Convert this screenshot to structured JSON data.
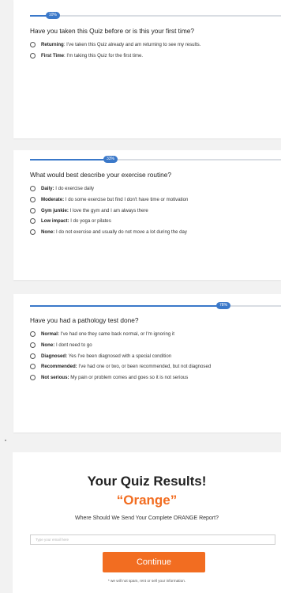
{
  "accent_color": "#3a78c9",
  "brand_color": "#f26d21",
  "cards": [
    {
      "progress": 10,
      "progress_label": "10%",
      "question": "Have you taken this Quiz before or is this your first time?",
      "options": [
        {
          "bold": "Returning",
          "text": ": I've taken this Quiz already and am returning to see my results."
        },
        {
          "bold": "First Time",
          "text": ": I'm taking this Quiz for the first time."
        }
      ]
    },
    {
      "progress": 33,
      "progress_label": "33%",
      "question": "What would best describe your exercise routine?",
      "options": [
        {
          "bold": "Daily:",
          "text": " I do exercise daily"
        },
        {
          "bold": "Moderate:",
          "text": " I do some exercise but find I don't have time or motivation"
        },
        {
          "bold": "Gym junkie:",
          "text": " I love the gym and I am always there"
        },
        {
          "bold": "Low impact:",
          "text": " I do yoga or pilates"
        },
        {
          "bold": "None:",
          "text": " I do not exercise and usually do not move a lot during the day"
        }
      ]
    },
    {
      "progress": 78,
      "progress_label": "78%",
      "question": "Have you had a pathology test done?",
      "options": [
        {
          "bold": "Normal:",
          "text": " I've had one they came back normal, or I'm ignoring it"
        },
        {
          "bold": "None:",
          "text": " I dont need to go"
        },
        {
          "bold": "Diagnosed:",
          "text": " Yes I've been diagnosed with a special condition"
        },
        {
          "bold": "Recommended:",
          "text": " I've had one or two, or been recommended, but not diagnosed"
        },
        {
          "bold": "Not serious:",
          "text": " My pain or problem comes and goes so it is not serious"
        }
      ]
    }
  ],
  "results": {
    "title": "Your Quiz Results!",
    "color_name": "“Orange”",
    "subtitle": "Where Should We Send Your Complete ORANGE Report?",
    "email_placeholder": "Type your email here",
    "email_value": "",
    "continue_label": "Continue",
    "disclaimer": "* we will not spam, rent or sell your information."
  }
}
